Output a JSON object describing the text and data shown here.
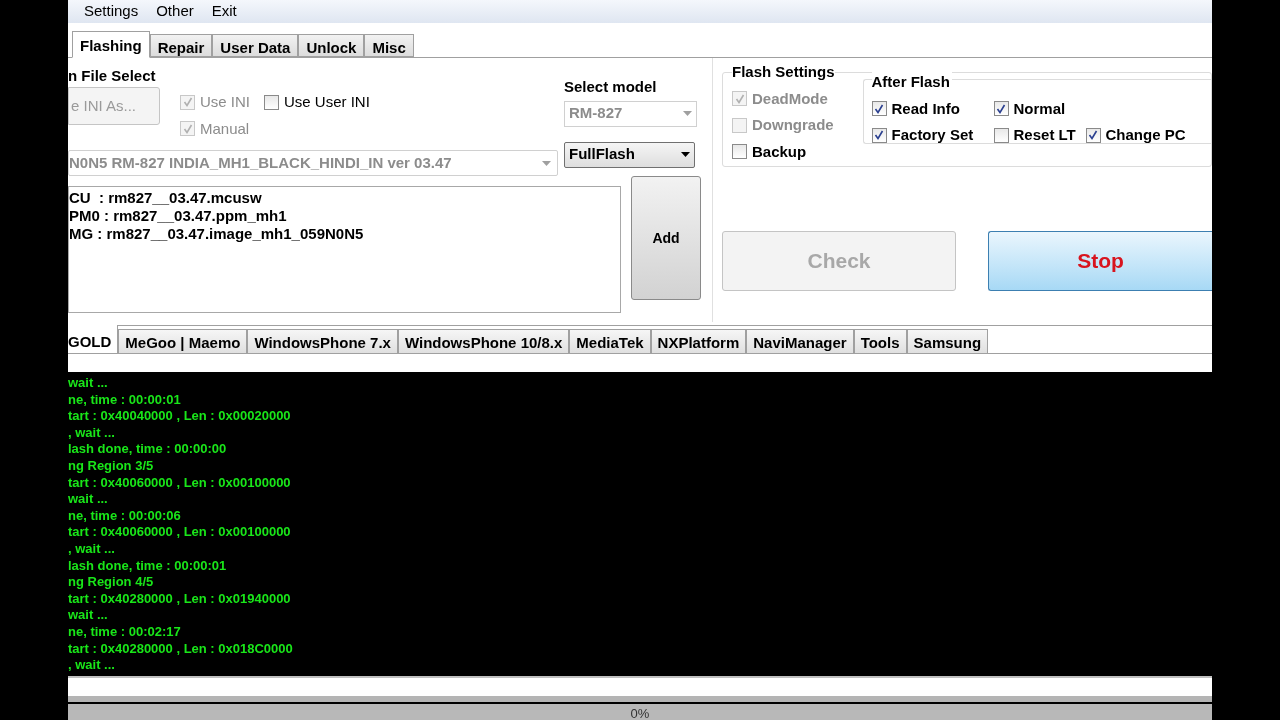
{
  "menu": [
    "Settings",
    "Other",
    "Exit"
  ],
  "tabs": [
    {
      "label": "Flashing",
      "selected": true
    },
    {
      "label": "Repair",
      "selected": false
    },
    {
      "label": "User Data",
      "selected": false
    },
    {
      "label": "Unlock",
      "selected": false
    },
    {
      "label": "Misc",
      "selected": false
    }
  ],
  "file_select": {
    "title": "n File Select",
    "save_button": {
      "label": "e INI As...",
      "disabled": true
    },
    "options": [
      {
        "label": "Use INI",
        "checked": true,
        "disabled": true
      },
      {
        "label": "Use User INI",
        "checked": false,
        "disabled": false
      },
      {
        "label": "Manual",
        "checked": true,
        "disabled": true
      }
    ],
    "firmware": {
      "value": "N0N5 RM-827 INDIA_MH1_BLACK_HINDI_IN ver 03.47",
      "disabled": true
    },
    "model_label": "Select model",
    "model": {
      "value": "RM-827",
      "disabled": true
    },
    "mode": {
      "value": "FullFlash",
      "disabled": false
    },
    "files": [
      "CU  : rm827__03.47.mcusw",
      "PM0 : rm827__03.47.ppm_mh1",
      "MG : rm827__03.47.image_mh1_059N0N5"
    ],
    "add_button": "Add"
  },
  "flash_settings": {
    "title": "Flash Settings",
    "options": [
      {
        "label": "DeadMode",
        "checked": true,
        "disabled": true
      },
      {
        "label": "Downgrade",
        "checked": false,
        "disabled": true
      },
      {
        "label": "Backup",
        "checked": false,
        "disabled": false
      }
    ]
  },
  "after_flash": {
    "title": "After Flash",
    "rows": [
      [
        {
          "label": "Read Info",
          "checked": true
        },
        {
          "label": "Normal",
          "checked": true
        }
      ],
      [
        {
          "label": "Factory Set",
          "checked": true
        },
        {
          "label": "Reset LT",
          "checked": false
        },
        {
          "label": "Change PC",
          "checked": true
        }
      ]
    ]
  },
  "check_button": {
    "label": "Check",
    "disabled": true
  },
  "stop_button": {
    "label": "Stop",
    "disabled": false
  },
  "platform_tabs": [
    {
      "label": "GOLD",
      "selected": true
    },
    {
      "label": "MeGoo | Maemo",
      "selected": false
    },
    {
      "label": "WindowsPhone 7.x",
      "selected": false
    },
    {
      "label": "WindowsPhone 10/8.x",
      "selected": false
    },
    {
      "label": "MediaTek",
      "selected": false
    },
    {
      "label": "NXPlatform",
      "selected": false
    },
    {
      "label": "NaviManager",
      "selected": false
    },
    {
      "label": "Tools",
      "selected": false
    },
    {
      "label": "Samsung",
      "selected": false
    }
  ],
  "log": [
    "wait ...",
    "ne, time : 00:00:01",
    "tart : 0x40040000 , Len : 0x00020000",
    ", wait ...",
    "lash done, time : 00:00:00",
    "ng Region 3/5",
    "tart : 0x40060000 , Len : 0x00100000",
    "wait ...",
    "ne, time : 00:00:06",
    "tart : 0x40060000 , Len : 0x00100000",
    ", wait ...",
    "lash done, time : 00:00:01",
    "ng Region 4/5",
    "tart : 0x40280000 , Len : 0x01940000",
    "wait ...",
    "ne, time : 00:02:17",
    "tart : 0x40280000 , Len : 0x018C0000",
    ", wait ..."
  ],
  "progress": {
    "level": 0,
    "label": "0%"
  }
}
